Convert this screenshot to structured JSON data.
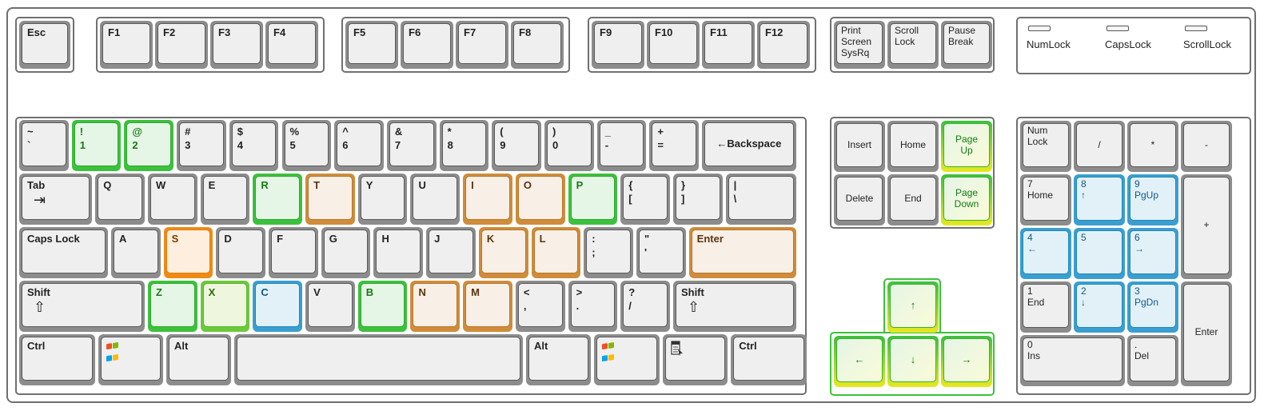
{
  "frame": {
    "title": ""
  },
  "colors": {
    "green": "#2fa82f",
    "lime": "#58b82a",
    "blue": "#2287b8",
    "tan": "#b6782a",
    "orange": "#e08010",
    "yellow": "#e8e820",
    "neutral": "#8c8c8c"
  },
  "esc": {
    "label": "Esc"
  },
  "function_keys": {
    "group1": [
      "F1",
      "F2",
      "F3",
      "F4"
    ],
    "group2": [
      "F5",
      "F6",
      "F7",
      "F8"
    ],
    "group3": [
      "F9",
      "F10",
      "F11",
      "F12"
    ]
  },
  "system_keys": [
    {
      "lines": [
        "Print",
        "Screen",
        "SysRq"
      ]
    },
    {
      "lines": [
        "Scroll",
        "Lock"
      ]
    },
    {
      "lines": [
        "Pause",
        "Break"
      ]
    }
  ],
  "indicators": [
    {
      "lines": [
        "Num",
        "Lock"
      ],
      "lit": false
    },
    {
      "lines": [
        "Caps",
        "Lock"
      ],
      "lit": false
    },
    {
      "lines": [
        "Scroll",
        "Lock"
      ],
      "lit": false
    }
  ],
  "main_rows": {
    "number_row": [
      {
        "top": "~",
        "bottom": "`",
        "highlight": "none"
      },
      {
        "top": "!",
        "bottom": "1",
        "highlight": "green"
      },
      {
        "top": "@",
        "bottom": "2",
        "highlight": "green"
      },
      {
        "top": "#",
        "bottom": "3",
        "highlight": "none"
      },
      {
        "top": "$",
        "bottom": "4",
        "highlight": "none"
      },
      {
        "top": "%",
        "bottom": "5",
        "highlight": "none"
      },
      {
        "top": "^",
        "bottom": "6",
        "highlight": "none"
      },
      {
        "top": "&",
        "bottom": "7",
        "highlight": "none"
      },
      {
        "top": "*",
        "bottom": "8",
        "highlight": "none"
      },
      {
        "top": "(",
        "bottom": "9",
        "highlight": "none"
      },
      {
        "top": ")",
        "bottom": "0",
        "highlight": "none"
      },
      {
        "top": "_",
        "bottom": "-",
        "highlight": "none"
      },
      {
        "top": "+",
        "bottom": "=",
        "highlight": "none"
      },
      {
        "label": "←Backspace",
        "highlight": "none"
      }
    ],
    "qwerty_row": [
      {
        "label": "Tab",
        "sub": "⇥",
        "highlight": "none"
      },
      {
        "label": "Q",
        "highlight": "none"
      },
      {
        "label": "W",
        "highlight": "none"
      },
      {
        "label": "E",
        "highlight": "none"
      },
      {
        "label": "R",
        "highlight": "green"
      },
      {
        "label": "T",
        "highlight": "tan"
      },
      {
        "label": "Y",
        "highlight": "none"
      },
      {
        "label": "U",
        "highlight": "none"
      },
      {
        "label": "I",
        "highlight": "tan"
      },
      {
        "label": "O",
        "highlight": "tan"
      },
      {
        "label": "P",
        "highlight": "green"
      },
      {
        "top": "{",
        "bottom": "[",
        "highlight": "none"
      },
      {
        "top": "}",
        "bottom": "]",
        "highlight": "none"
      },
      {
        "top": "|",
        "bottom": "\\",
        "highlight": "none"
      }
    ],
    "home_row": [
      {
        "label": "Caps Lock",
        "highlight": "none"
      },
      {
        "label": "A",
        "highlight": "none"
      },
      {
        "label": "S",
        "highlight": "orange"
      },
      {
        "label": "D",
        "highlight": "none"
      },
      {
        "label": "F",
        "highlight": "none"
      },
      {
        "label": "G",
        "highlight": "none"
      },
      {
        "label": "H",
        "highlight": "none"
      },
      {
        "label": "J",
        "highlight": "none"
      },
      {
        "label": "K",
        "highlight": "tan"
      },
      {
        "label": "L",
        "highlight": "tan"
      },
      {
        "top": ":",
        "bottom": ";",
        "highlight": "none"
      },
      {
        "top": "\"",
        "bottom": "'",
        "highlight": "none"
      },
      {
        "label": "Enter",
        "highlight": "tan"
      }
    ],
    "shift_row": [
      {
        "label": "Shift",
        "sub": "⇧",
        "highlight": "none"
      },
      {
        "label": "Z",
        "highlight": "green"
      },
      {
        "label": "X",
        "highlight": "lime"
      },
      {
        "label": "C",
        "highlight": "blue"
      },
      {
        "label": "V",
        "highlight": "none"
      },
      {
        "label": "B",
        "highlight": "green"
      },
      {
        "label": "N",
        "highlight": "tan"
      },
      {
        "label": "M",
        "highlight": "tan"
      },
      {
        "top": "<",
        "bottom": ",",
        "highlight": "none"
      },
      {
        "top": ">",
        "bottom": ".",
        "highlight": "none"
      },
      {
        "top": "?",
        "bottom": "/",
        "highlight": "none"
      },
      {
        "label": "Shift",
        "sub": "⇧",
        "highlight": "none"
      }
    ],
    "bottom_row": [
      {
        "label": "Ctrl",
        "highlight": "none"
      },
      {
        "icon": "windows-logo-icon",
        "highlight": "none"
      },
      {
        "label": "Alt",
        "highlight": "none"
      },
      {
        "label": "",
        "name": "space",
        "highlight": "none"
      },
      {
        "label": "Alt",
        "highlight": "none"
      },
      {
        "icon": "windows-logo-icon",
        "highlight": "none"
      },
      {
        "icon": "context-menu-icon",
        "highlight": "none"
      },
      {
        "label": "Ctrl",
        "highlight": "none"
      }
    ]
  },
  "navigation_keys": [
    {
      "label": "Insert",
      "highlight": "none"
    },
    {
      "label": "Home",
      "highlight": "none"
    },
    {
      "lines": [
        "Page",
        "Up"
      ],
      "highlight": "yellow"
    },
    {
      "label": "Delete",
      "highlight": "none"
    },
    {
      "label": "End",
      "highlight": "none"
    },
    {
      "lines": [
        "Page",
        "Down"
      ],
      "highlight": "yellow"
    }
  ],
  "arrow_keys": [
    {
      "label": "↑",
      "name": "up",
      "highlight": "yellow"
    },
    {
      "label": "←",
      "name": "left",
      "highlight": "yellow"
    },
    {
      "label": "↓",
      "name": "down",
      "highlight": "yellow"
    },
    {
      "label": "→",
      "name": "right",
      "highlight": "yellow"
    }
  ],
  "numpad": [
    {
      "lines": [
        "Num",
        "Lock"
      ],
      "highlight": "none"
    },
    {
      "label": "/",
      "highlight": "none"
    },
    {
      "label": "*",
      "highlight": "none"
    },
    {
      "label": "-",
      "highlight": "none"
    },
    {
      "lines": [
        "7",
        "Home"
      ],
      "highlight": "none"
    },
    {
      "lines": [
        "8",
        "↑"
      ],
      "highlight": "blue"
    },
    {
      "lines": [
        "9",
        "PgUp"
      ],
      "highlight": "blue"
    },
    {
      "label": "+",
      "highlight": "none"
    },
    {
      "lines": [
        "4",
        "←"
      ],
      "highlight": "blue"
    },
    {
      "lines": [
        "5",
        ""
      ],
      "highlight": "blue"
    },
    {
      "lines": [
        "6",
        "→"
      ],
      "highlight": "blue"
    },
    {
      "lines": [
        "1",
        "End"
      ],
      "highlight": "none"
    },
    {
      "lines": [
        "2",
        "↓"
      ],
      "highlight": "blue"
    },
    {
      "lines": [
        "3",
        "PgDn"
      ],
      "highlight": "blue"
    },
    {
      "label": "Enter",
      "highlight": "none"
    },
    {
      "lines": [
        "0",
        "Ins"
      ],
      "highlight": "none"
    },
    {
      "lines": [
        ".",
        "Del"
      ],
      "highlight": "none"
    }
  ]
}
